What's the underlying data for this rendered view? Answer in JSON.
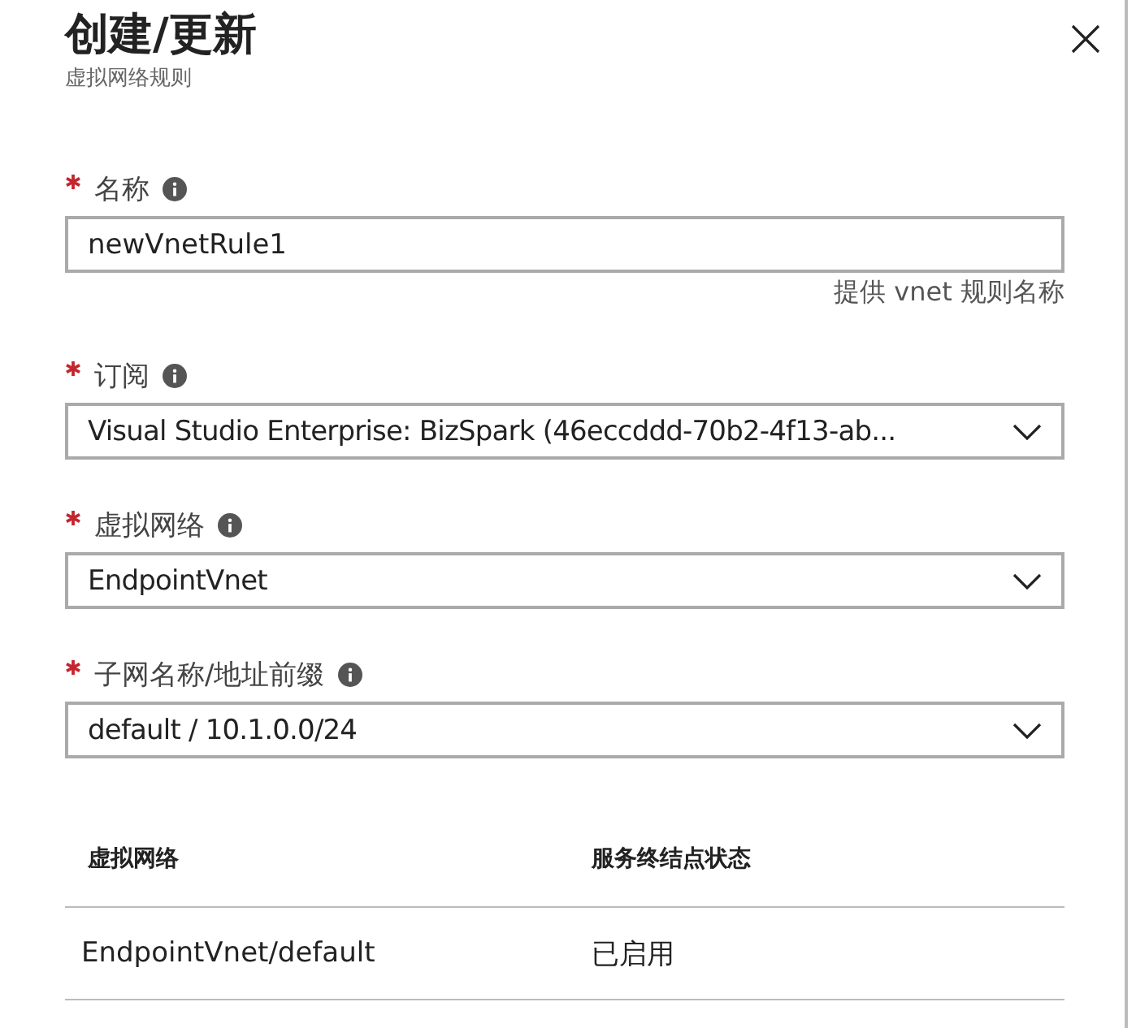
{
  "panel": {
    "title": "创建/更新",
    "subtitle": "虚拟网络规则"
  },
  "fields": [
    {
      "kind": "text",
      "label": "名称",
      "required": true,
      "value": "newVnetRule1",
      "hint": "提供 vnet 规则名称"
    },
    {
      "kind": "select",
      "label": "订阅",
      "required": true,
      "value": "Visual Studio Enterprise: BizSpark (46eccddd-70b2-4f13-ab..."
    },
    {
      "kind": "select",
      "label": "虚拟网络",
      "required": true,
      "value": "EndpointVnet"
    },
    {
      "kind": "select",
      "label": "子网名称/地址前缀",
      "required": true,
      "value": "default / 10.1.0.0/24"
    }
  ],
  "table": {
    "columns": [
      "虚拟网络",
      "服务终结点状态"
    ],
    "rows": [
      [
        "EndpointVnet/default",
        "已启用"
      ]
    ]
  }
}
